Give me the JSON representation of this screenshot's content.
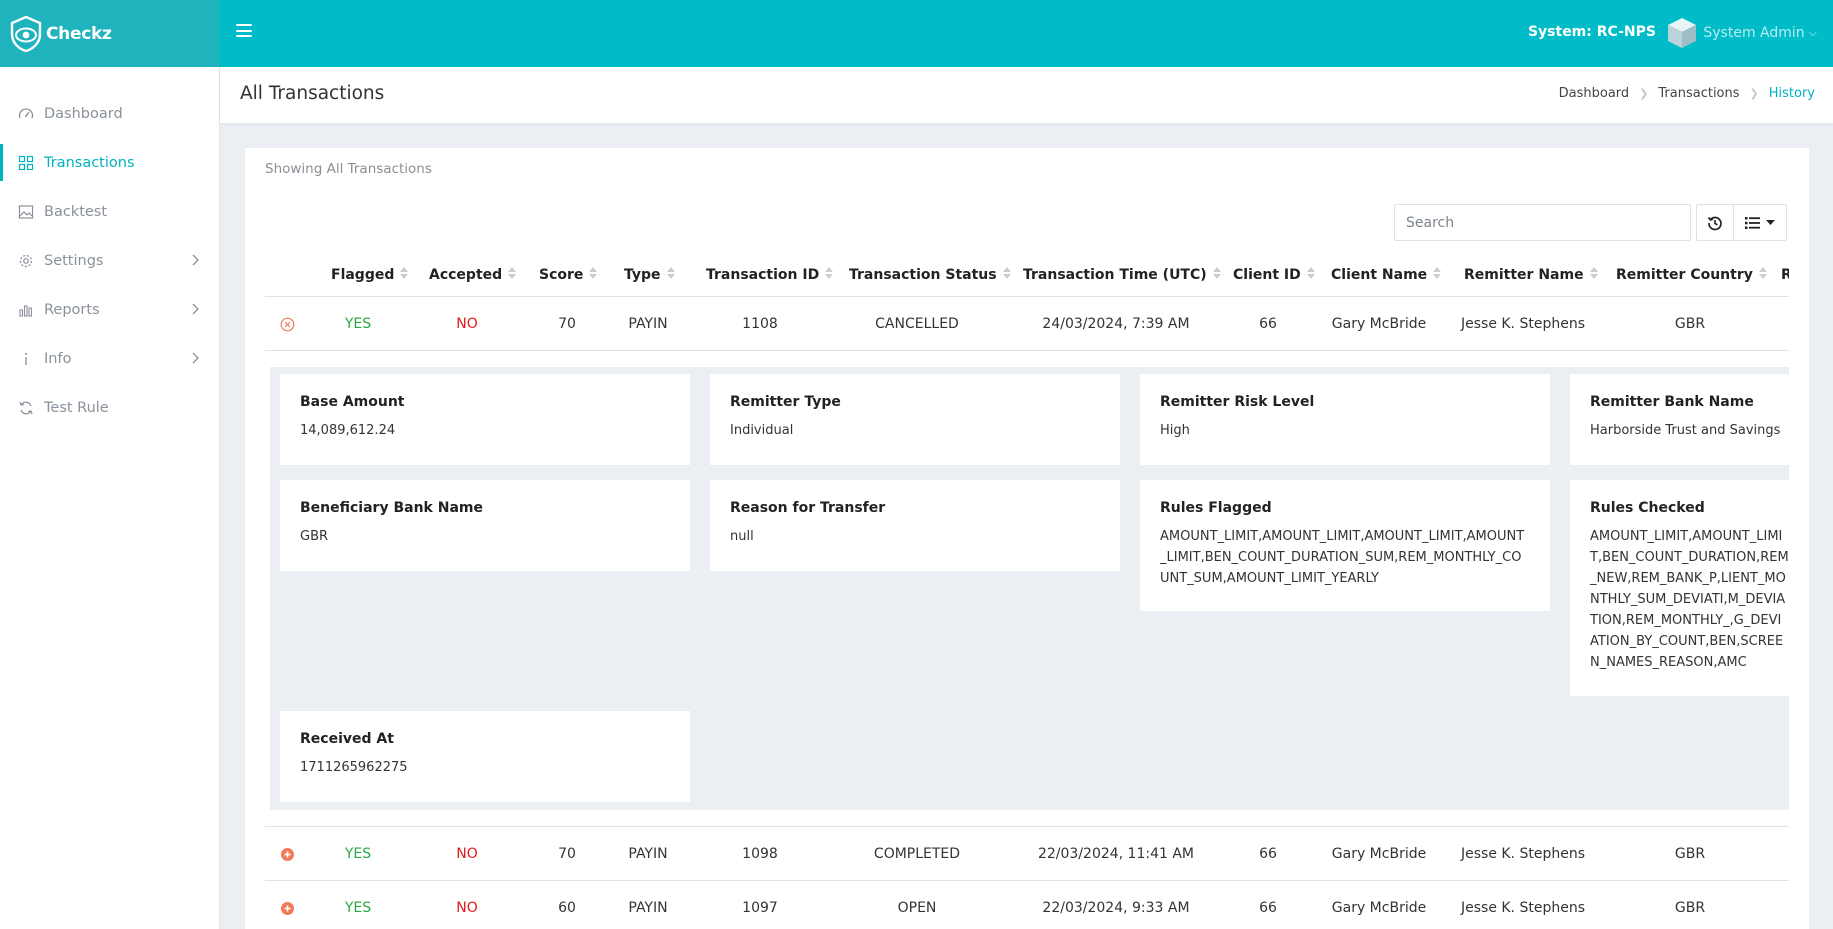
{
  "brand": {
    "name": "Checkz"
  },
  "header": {
    "system_label": "System: RC-NPS",
    "user_name": "System Admin"
  },
  "sidebar": {
    "items": [
      {
        "label": "Dashboard",
        "icon": "gauge-icon"
      },
      {
        "label": "Transactions",
        "icon": "grid-icon",
        "active": true
      },
      {
        "label": "Backtest",
        "icon": "image-icon"
      },
      {
        "label": "Settings",
        "icon": "gear-icon",
        "has_children": true
      },
      {
        "label": "Reports",
        "icon": "bar-chart-icon",
        "has_children": true
      },
      {
        "label": "Info",
        "icon": "info-icon",
        "has_children": true
      },
      {
        "label": "Test Rule",
        "icon": "refresh-icon"
      }
    ]
  },
  "page": {
    "title": "All Transactions",
    "breadcrumb": [
      "Dashboard",
      "Transactions",
      "History"
    ]
  },
  "card": {
    "subtitle": "Showing All Transactions",
    "search_placeholder": "Search"
  },
  "table": {
    "columns": [
      "Flagged",
      "Accepted",
      "Score",
      "Type",
      "Transaction ID",
      "Transaction Status",
      "Transaction Time (UTC)",
      "Client ID",
      "Client Name",
      "Remitter Name",
      "Remitter Country",
      "Re"
    ],
    "rows": [
      {
        "flagged": "YES",
        "accepted": "NO",
        "score": "70",
        "type": "PAYIN",
        "id": "1108",
        "status": "CANCELLED",
        "time": "24/03/2024, 7:39 AM",
        "client_id": "66",
        "client_name": "Gary McBride",
        "remitter_name": "Jesse K. Stephens",
        "remitter_country": "GBR",
        "expanded": true
      },
      {
        "flagged": "YES",
        "accepted": "NO",
        "score": "70",
        "type": "PAYIN",
        "id": "1098",
        "status": "COMPLETED",
        "time": "22/03/2024, 11:41 AM",
        "client_id": "66",
        "client_name": "Gary McBride",
        "remitter_name": "Jesse K. Stephens",
        "remitter_country": "GBR"
      },
      {
        "flagged": "YES",
        "accepted": "NO",
        "score": "60",
        "type": "PAYIN",
        "id": "1097",
        "status": "OPEN",
        "time": "22/03/2024, 9:33 AM",
        "client_id": "66",
        "client_name": "Gary McBride",
        "remitter_name": "Jesse K. Stephens",
        "remitter_country": "GBR"
      }
    ]
  },
  "details": {
    "base_amount": {
      "label": "Base Amount",
      "value": "14,089,612.24"
    },
    "remitter_type": {
      "label": "Remitter Type",
      "value": "Individual"
    },
    "remitter_risk_level": {
      "label": "Remitter Risk Level",
      "value": "High"
    },
    "remitter_bank_name": {
      "label": "Remitter Bank Name",
      "value": "Harborside Trust and Savings"
    },
    "beneficiary_bank_name": {
      "label": "Beneficiary Bank Name",
      "value": "GBR"
    },
    "reason_for_transfer": {
      "label": "Reason for Transfer",
      "value": "null"
    },
    "rules_flagged": {
      "label": "Rules Flagged",
      "value": "AMOUNT_LIMIT,AMOUNT_LIMIT,AMOUNT_LIMIT,AMOUNT_LIMIT,BEN_COUNT_DURATION_SUM,REM_MONTHLY_COUNT_SUM,AMOUNT_LIMIT_YEARLY"
    },
    "rules_checked": {
      "label": "Rules Checked",
      "value": "AMOUNT_LIMIT,AMOUNT_LIMIT,BEN_COUNT_DURATION,REM_NEW,REM_BANK_P,LIENT_MONTHLY_SUM_DEVIATI,M_DEVIATION,REM_MONTHLY_,G_DEVIATION_BY_COUNT,BEN,SCREEN_NAMES_REASON,AMC"
    },
    "received_at": {
      "label": "Received At",
      "value": "1711265962275"
    }
  },
  "colors": {
    "accent": "#00bcc8",
    "brand_bg": "#1fb3bd",
    "yes": "#28a745",
    "no": "#e31b1b",
    "row_icon": "#f07a5a"
  }
}
